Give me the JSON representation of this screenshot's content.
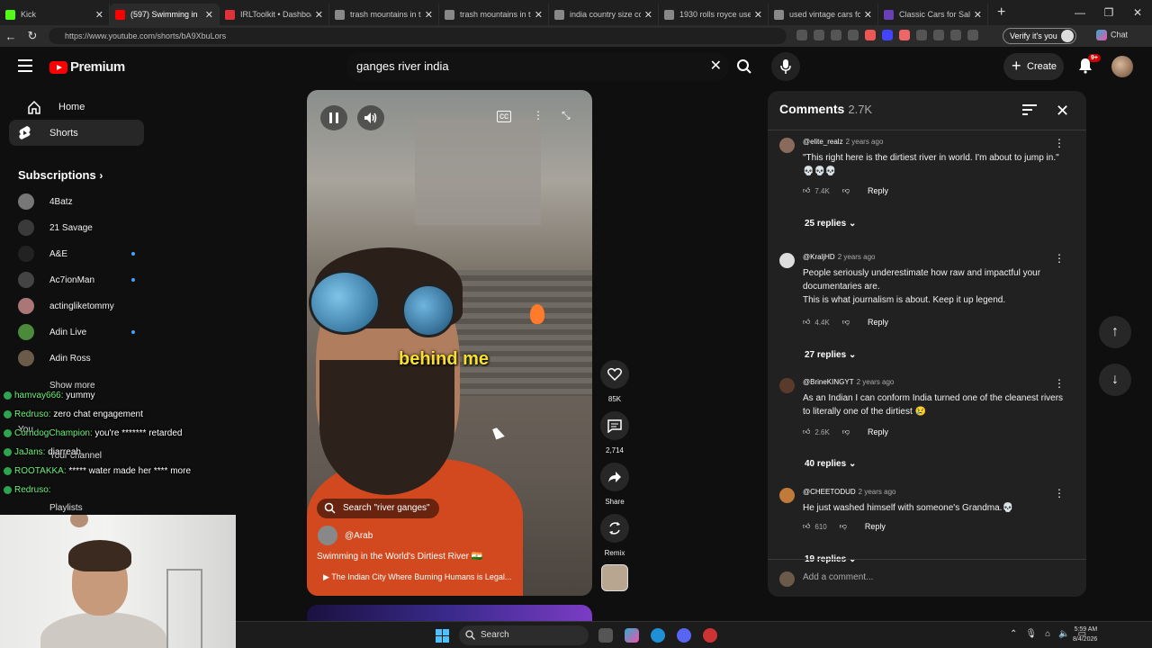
{
  "browser": {
    "tabs": [
      {
        "title": "Kick",
        "color": "#53fc18"
      },
      {
        "title": "(597) Swimming in",
        "color": "#ff0000",
        "active": true
      },
      {
        "title": "IRLToolkit • Dashboard",
        "color": "#e0313b"
      },
      {
        "title": "trash mountains in the",
        "color": "#888888"
      },
      {
        "title": "trash mountains in the",
        "color": "#888888"
      },
      {
        "title": "india country size comp",
        "color": "#888888"
      },
      {
        "title": "1930 rolls royce used un",
        "color": "#888888"
      },
      {
        "title": "used vintage cars for sal",
        "color": "#888888"
      },
      {
        "title": "Classic Cars for Sale Ne",
        "color": "#6a3fb5"
      }
    ],
    "url": "https://www.youtube.com/shorts/bA9XbuLors",
    "verify_label": "Verify it's you",
    "chat_label": "Chat"
  },
  "header": {
    "logo_text": "Premium",
    "search_value": "ganges river india",
    "create_label": "Create",
    "notif_count": "9+"
  },
  "sidebar": {
    "items": [
      {
        "label": "Home",
        "icon": "home-icon"
      },
      {
        "label": "Shorts",
        "icon": "shorts-icon",
        "selected": true
      }
    ],
    "subscriptions_label": "Subscriptions",
    "subscriptions": [
      {
        "name": "4Batz",
        "color": "#777777",
        "live": false
      },
      {
        "name": "21 Savage",
        "color": "#3a3a3a",
        "live": false
      },
      {
        "name": "A&E",
        "color": "#222222",
        "live": true
      },
      {
        "name": "Ac7ionMan",
        "color": "#444444",
        "live": true
      },
      {
        "name": "actingliketommy",
        "color": "#a77",
        "live": false
      },
      {
        "name": "Adin Live",
        "color": "#4a8a3a",
        "live": true
      },
      {
        "name": "Adin Ross",
        "color": "#6a5a4a",
        "live": false
      }
    ],
    "show_more": "Show more",
    "you_label": "You",
    "your_channel": "Your channel",
    "playlists": "Playlists"
  },
  "chat_overlay": [
    {
      "user": "hamvay666:",
      "msg": " yummy"
    },
    {
      "user": "Redruso:",
      "msg": " zero chat engagement"
    },
    {
      "user": "CorndogChampion:",
      "msg": " you're ******* retarded"
    },
    {
      "user": "JaJans:",
      "msg": " diarreah"
    },
    {
      "user": "ROOTAKKA:",
      "msg": " ***** water made her **** more"
    },
    {
      "user": "Redruso:",
      "msg": ""
    }
  ],
  "video": {
    "caption": "behind me",
    "search_chip": "Search \"river ganges\"",
    "channel": "@Arab",
    "title": "Swimming in the World's Dirtiest River 🇮🇳",
    "link": "The Indian City Where Burning Humans is Legal..."
  },
  "actions": {
    "likes": "85K",
    "comments": "2,714",
    "share": "Share",
    "remix": "Remix"
  },
  "comments": {
    "title": "Comments",
    "count": "2.7K",
    "add_placeholder": "Add a comment...",
    "items": [
      {
        "user": "@elite_realz",
        "time": "2 years ago",
        "text": "\"This right here is the dirtiest river in world. I'm about to jump in.\" 💀💀💀",
        "likes": "7.4K",
        "replies": "25 replies",
        "avatar": "#8a6a5a"
      },
      {
        "user": "@KraljHD",
        "time": "2 years ago",
        "text": "People seriously underestimate how raw and impactful your documentaries are.\nThis is what journalism is about. Keep it up legend.",
        "likes": "4.4K",
        "replies": "27 replies",
        "avatar": "#dddddd"
      },
      {
        "user": "@BrineKINGYT",
        "time": "2 years ago",
        "text": "As an Indian I can conform India turned one of the cleanest rivers to literally one of the dirtiest 😢",
        "likes": "2.6K",
        "replies": "40 replies",
        "avatar": "#5a3a2a"
      },
      {
        "user": "@CHEETODUD",
        "time": "2 years ago",
        "text": "He just washed himself with someone's Grandma.💀",
        "likes": "610",
        "replies": "19 replies",
        "avatar": "#c07a3a"
      }
    ],
    "reply_label": "Reply"
  },
  "taskbar": {
    "search_label": "Search",
    "time": "5:59 AM",
    "date": "8/4/2026"
  }
}
